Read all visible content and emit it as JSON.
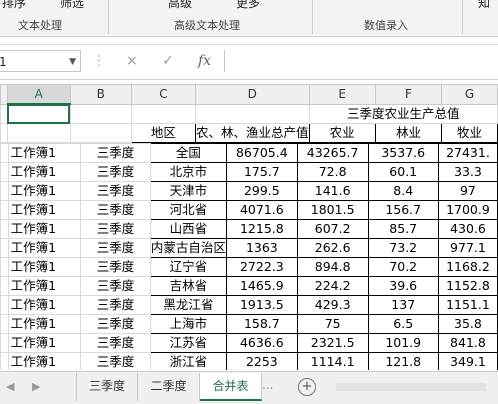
{
  "ribbon": {
    "top_labels": [
      "排序",
      "筛选",
      "高级",
      "更多",
      "知"
    ],
    "groups": [
      "文本处理",
      "高级文本处理",
      "数值录入"
    ]
  },
  "formula_bar": {
    "name_box": "1",
    "cancel": "×",
    "enter": "✓",
    "fx": "fx",
    "value": ""
  },
  "columns": [
    "",
    "A",
    "B",
    "C",
    "D",
    "E",
    "F",
    "G"
  ],
  "sheet": {
    "title": "三季度农业生产总值",
    "headers": [
      "地区",
      "农、林、渔业总产值",
      "农业",
      "林业",
      "牧业"
    ],
    "rows": [
      {
        "a": "工作簿1",
        "b": "三季度",
        "c": "全国",
        "d": "86705.4",
        "e": "43265.7",
        "f": "3537.6",
        "g": "27431."
      },
      {
        "a": "工作簿1",
        "b": "三季度",
        "c": "北京市",
        "d": "175.7",
        "e": "72.8",
        "f": "60.1",
        "g": "33.3"
      },
      {
        "a": "工作簿1",
        "b": "三季度",
        "c": "天津市",
        "d": "299.5",
        "e": "141.6",
        "f": "8.4",
        "g": "97"
      },
      {
        "a": "工作簿1",
        "b": "三季度",
        "c": "河北省",
        "d": "4071.6",
        "e": "1801.5",
        "f": "156.7",
        "g": "1700.9"
      },
      {
        "a": "工作簿1",
        "b": "三季度",
        "c": "山西省",
        "d": "1215.8",
        "e": "607.2",
        "f": "85.7",
        "g": "430.6"
      },
      {
        "a": "工作簿1",
        "b": "三季度",
        "c": "内蒙古自治区",
        "d": "1363",
        "e": "262.6",
        "f": "73.2",
        "g": "977.1"
      },
      {
        "a": "工作簿1",
        "b": "三季度",
        "c": "辽宁省",
        "d": "2722.3",
        "e": "894.8",
        "f": "70.2",
        "g": "1168.2"
      },
      {
        "a": "工作簿1",
        "b": "三季度",
        "c": "吉林省",
        "d": "1465.9",
        "e": "224.2",
        "f": "39.6",
        "g": "1152.8"
      },
      {
        "a": "工作簿1",
        "b": "三季度",
        "c": "黑龙江省",
        "d": "1913.5",
        "e": "429.3",
        "f": "137",
        "g": "1151.1"
      },
      {
        "a": "工作簿1",
        "b": "三季度",
        "c": "上海市",
        "d": "158.7",
        "e": "75",
        "f": "6.5",
        "g": "35.8"
      },
      {
        "a": "工作簿1",
        "b": "三季度",
        "c": "江苏省",
        "d": "4636.6",
        "e": "2321.5",
        "f": "101.9",
        "g": "841.8"
      },
      {
        "a": "工作簿1",
        "b": "三季度",
        "c": "浙江省",
        "d": "2253",
        "e": "1114.1",
        "f": "121.8",
        "g": "349.1"
      }
    ]
  },
  "tabs": [
    "三季度",
    "二季度",
    "合并表"
  ],
  "active_tab": "合并表",
  "tab_nav": {
    "prev": "◀",
    "next": "▶",
    "more": "...",
    "add": "+"
  },
  "colors": {
    "accent": "#217346"
  }
}
